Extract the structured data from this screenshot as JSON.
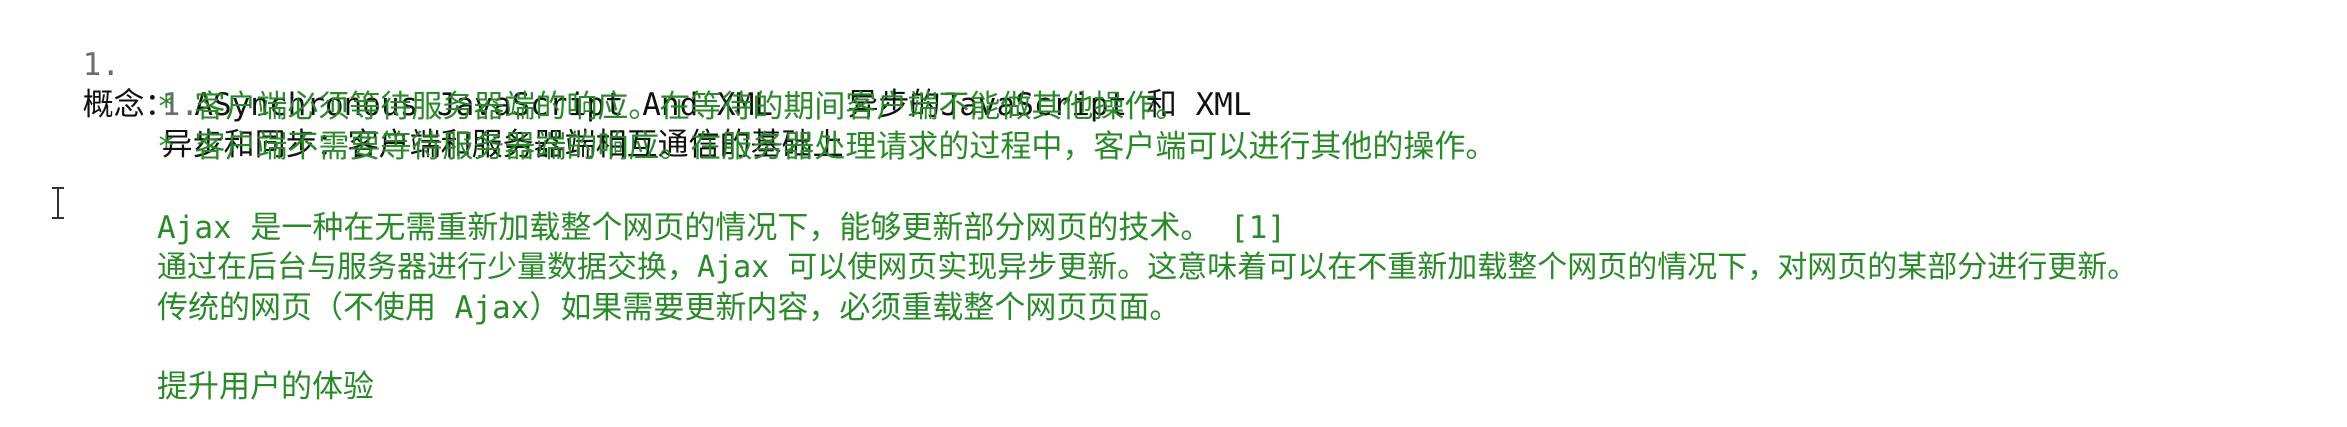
{
  "outline": {
    "item1": {
      "number": "1.",
      "text": "概念： ASynchronous JavaScript And XML    异步的JavaScript 和 XML"
    },
    "item1_1": {
      "number": "1.",
      "text": "异步和同步：客户端和服务器端相互通信的基础上"
    },
    "bullets": [
      "* 客户端必须等待服务器端的响应。在等待的期间客户端不能做其他操作。",
      "* 客户端不需要等待服务器端的响应。在服务器处理请求的过程中，客户端可以进行其他的操作。"
    ],
    "paragraph": [
      "Ajax 是一种在无需重新加载整个网页的情况下，能够更新部分网页的技术。 [1]",
      "通过在后台与服务器进行少量数据交换，Ajax 可以使网页实现异步更新。这意味着可以在不重新加载整个网页的情况下，对网页的某部分进行更新。",
      "传统的网页（不使用 Ajax）如果需要更新内容，必须重载整个网页页面。"
    ],
    "summary": "提升用户的体验"
  },
  "colors": {
    "text": "#111111",
    "number": "#6b6b6b",
    "green": "#2a8a2a",
    "background": "#ffffff"
  },
  "icons": {
    "caret": "text-cursor-icon"
  }
}
